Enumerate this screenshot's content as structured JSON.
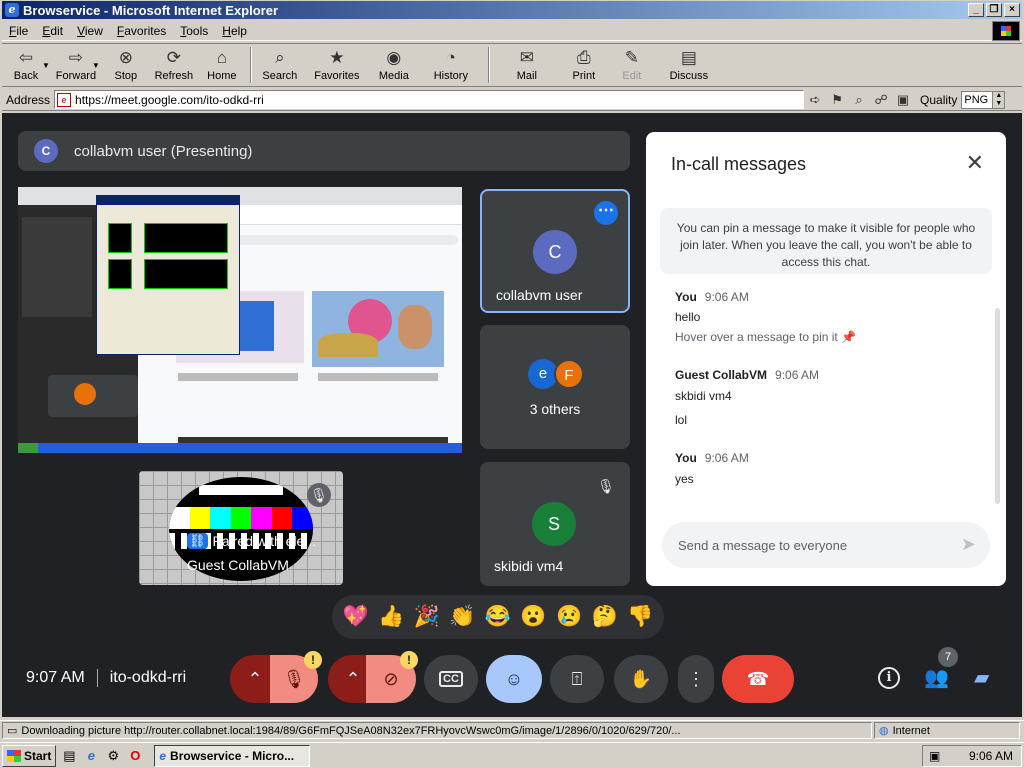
{
  "window": {
    "title": "Browservice - Microsoft Internet Explorer"
  },
  "menu": [
    "File",
    "Edit",
    "View",
    "Favorites",
    "Tools",
    "Help"
  ],
  "toolbar": {
    "back": "Back",
    "forward": "Forward",
    "stop": "Stop",
    "refresh": "Refresh",
    "home": "Home",
    "search": "Search",
    "favorites": "Favorites",
    "media": "Media",
    "history": "History",
    "mail": "Mail",
    "print": "Print",
    "edit": "Edit",
    "discuss": "Discuss"
  },
  "address": {
    "label": "Address",
    "url": "https://meet.google.com/ito-odkd-rri",
    "quality_label": "Quality",
    "quality_value": "PNG"
  },
  "meet": {
    "presenter_initial": "C",
    "presenter_label": "collabvm user (Presenting)",
    "tile_user": {
      "initial": "C",
      "name": "collabvm user"
    },
    "tile_others": {
      "a": "e",
      "b": "F",
      "label": "3 others"
    },
    "tile_skibidi": {
      "initial": "S",
      "name": "skibidi vm4"
    },
    "tile_guest": {
      "paired": "Paired with ele...",
      "name": "Guest CollabVM"
    },
    "reactions": [
      "💖",
      "👍",
      "🎉",
      "👏",
      "😂",
      "😮",
      "😢",
      "🤔",
      "👎"
    ],
    "time": "9:07 AM",
    "meeting_code": "ito-odkd-rri",
    "people_count": "7"
  },
  "chat": {
    "heading": "In-call messages",
    "pin_note": "You can pin a message to make it visible for people who join later. When you leave the call, you won't be able to access this chat.",
    "messages": [
      {
        "sender": "You",
        "time": "9:06 AM",
        "text": "hello",
        "hint": "Hover over a message to pin it"
      },
      {
        "sender": "Guest CollabVM",
        "time": "9:06 AM",
        "text1": "skbidi vm4",
        "text2": "lol"
      },
      {
        "sender": "You",
        "time": "9:06 AM",
        "text": "yes"
      }
    ],
    "placeholder": "Send a message to everyone"
  },
  "status": {
    "text": "Downloading picture http://router.collabnet.local:1984/89/G6FmFQJSeA08N32ex7FRHyovcWswc0mG/image/1/2896/0/1020/629/720/...",
    "zone": "Internet"
  },
  "taskbar": {
    "start": "Start",
    "item": "Browservice - Micro...",
    "clock": "9:06 AM"
  }
}
